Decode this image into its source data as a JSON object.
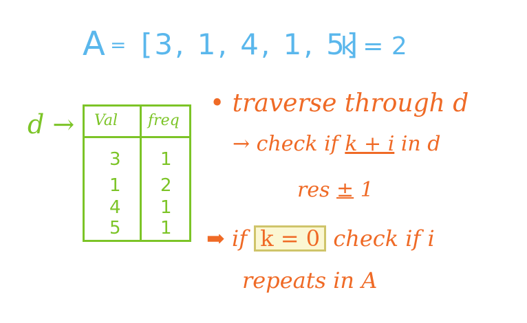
{
  "header": {
    "array_name": "A",
    "equals": "=",
    "array_literal": "[3, 1, 4, 1, 5]",
    "k_assignment": "k = 2"
  },
  "dict_label": "d →",
  "table": {
    "columns": [
      "Val",
      "freq"
    ],
    "rows": [
      {
        "val": "3",
        "freq": "1"
      },
      {
        "val": "1",
        "freq": "2"
      },
      {
        "val": "4",
        "freq": "1"
      },
      {
        "val": "5",
        "freq": "1"
      }
    ]
  },
  "notes": {
    "line1": "• traverse through d",
    "line2_prefix": "→ check if ",
    "line2_k": "k + i",
    "line2_suffix": " in d",
    "line3_prefix": "res ",
    "line3_pm": "±",
    "line3_suffix": " 1",
    "line4_arrow": "➡",
    "line4_if": " if ",
    "line4_cond": "k = 0",
    "line4_suffix": "  check if i",
    "line5": "repeats in A"
  },
  "colors": {
    "header": "#5ab7ec",
    "table": "#7cc427",
    "notes": "#ef6a26",
    "highlight_box": "#cfc46a"
  }
}
